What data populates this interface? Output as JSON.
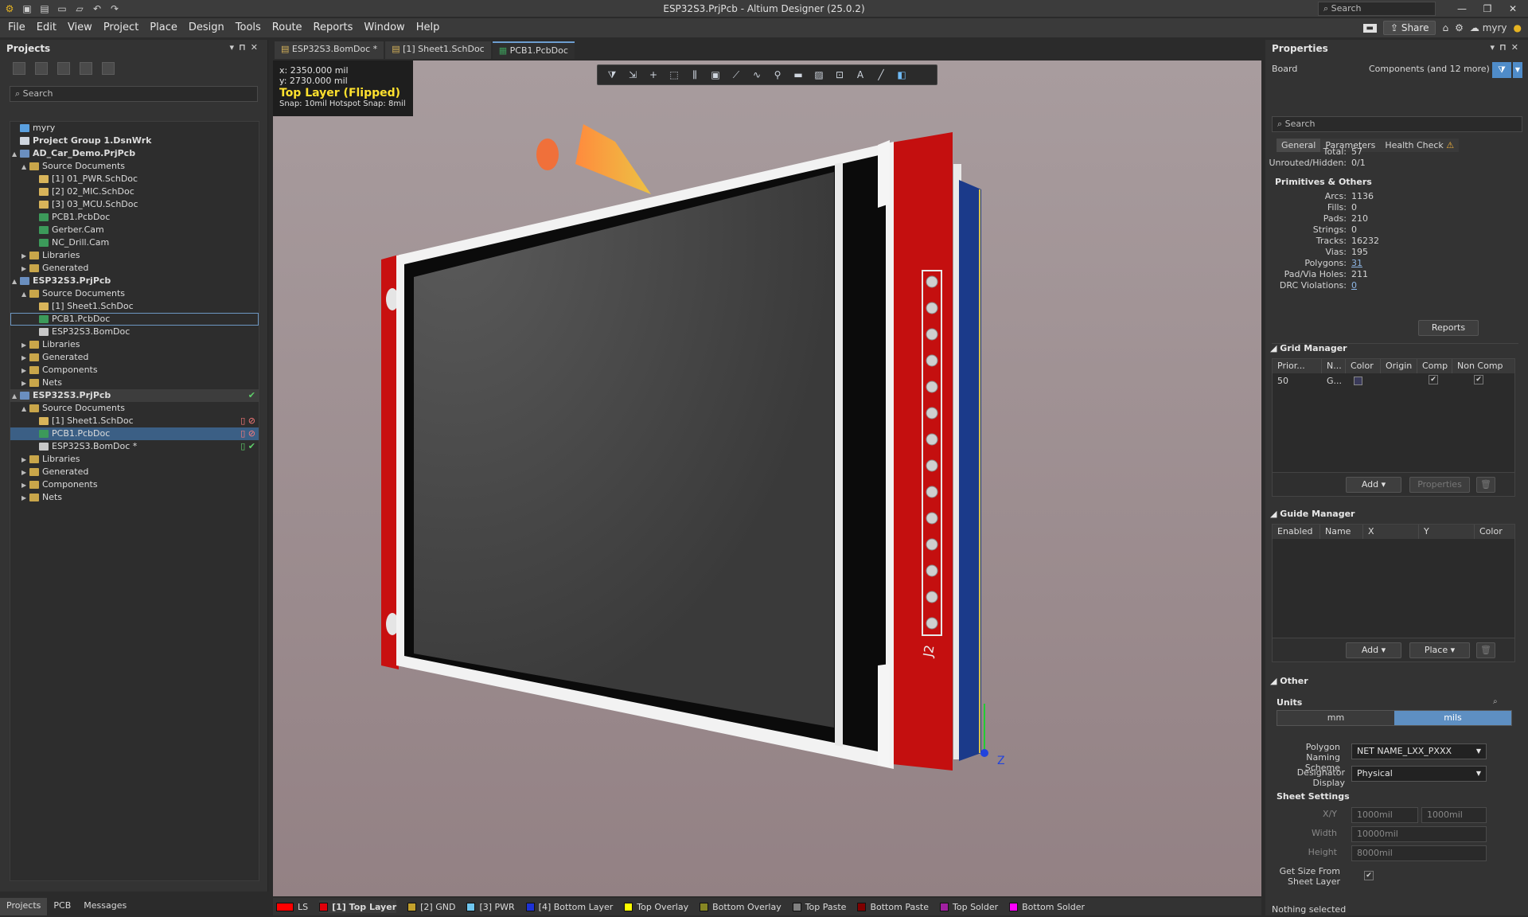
{
  "app": {
    "title": "ESP32S3.PrjPcb - Altium Designer (25.0.2)",
    "search_placeholder": "Search",
    "share_label": "Share",
    "user": "myry"
  },
  "menu": [
    "File",
    "Edit",
    "View",
    "Project",
    "Place",
    "Design",
    "Tools",
    "Route",
    "Reports",
    "Window",
    "Help"
  ],
  "projects_panel": {
    "title": "Projects",
    "search_placeholder": "Search",
    "tree": [
      {
        "label": "myry",
        "icon": "cloud-icon",
        "level": 0
      },
      {
        "label": "Project Group 1.DsnWrk",
        "icon": "workspace-icon",
        "level": 0,
        "bold": true
      },
      {
        "label": "AD_Car_Demo.PrjPcb",
        "icon": "project-icon",
        "level": 0,
        "bold": true,
        "expander": "▲"
      },
      {
        "label": "Source Documents",
        "icon": "folder-icon",
        "level": 1,
        "expander": "▲"
      },
      {
        "label": "[1] 01_PWR.SchDoc",
        "icon": "schematic-icon",
        "level": 2
      },
      {
        "label": "[2] 02_MIC.SchDoc",
        "icon": "schematic-icon",
        "level": 2
      },
      {
        "label": "[3] 03_MCU.SchDoc",
        "icon": "schematic-icon",
        "level": 2
      },
      {
        "label": "PCB1.PcbDoc",
        "icon": "pcb-icon",
        "level": 2
      },
      {
        "label": "Gerber.Cam",
        "icon": "cam-icon",
        "level": 2
      },
      {
        "label": "NC_Drill.Cam",
        "icon": "cam-icon",
        "level": 2
      },
      {
        "label": "Libraries",
        "icon": "folder-icon",
        "level": 1,
        "expander": "▶"
      },
      {
        "label": "Generated",
        "icon": "folder-icon",
        "level": 1,
        "expander": "▶"
      },
      {
        "label": "ESP32S3.PrjPcb",
        "icon": "project-icon",
        "level": 0,
        "bold": true,
        "expander": "▲"
      },
      {
        "label": "Source Documents",
        "icon": "folder-icon",
        "level": 1,
        "expander": "▲"
      },
      {
        "label": "[1] Sheet1.SchDoc",
        "icon": "schematic-icon",
        "level": 2
      },
      {
        "label": "PCB1.PcbDoc",
        "icon": "pcb-icon",
        "level": 2,
        "outline": true
      },
      {
        "label": "ESP32S3.BomDoc",
        "icon": "bom-icon",
        "level": 2
      },
      {
        "label": "Libraries",
        "icon": "folder-icon",
        "level": 1,
        "expander": "▶"
      },
      {
        "label": "Generated",
        "icon": "folder-icon",
        "level": 1,
        "expander": "▶"
      },
      {
        "label": "Components",
        "icon": "folder-icon",
        "level": 1,
        "expander": "▶"
      },
      {
        "label": "Nets",
        "icon": "folder-icon",
        "level": 1,
        "expander": "▶"
      },
      {
        "label": "ESP32S3.PrjPcb",
        "icon": "project-icon",
        "level": 0,
        "bold": true,
        "expander": "▲",
        "status": "✔",
        "active": true
      },
      {
        "label": "Source Documents",
        "icon": "folder-icon",
        "level": 1,
        "expander": "▲"
      },
      {
        "label": "[1] Sheet1.SchDoc",
        "icon": "schematic-icon",
        "level": 2,
        "status": "▯ ⊘"
      },
      {
        "label": "PCB1.PcbDoc",
        "icon": "pcb-icon",
        "level": 2,
        "selected": true,
        "status": "▯ ⊘"
      },
      {
        "label": "ESP32S3.BomDoc *",
        "icon": "bom-icon",
        "level": 2,
        "status": "▯ ✔"
      },
      {
        "label": "Libraries",
        "icon": "folder-icon",
        "level": 1,
        "expander": "▶"
      },
      {
        "label": "Generated",
        "icon": "folder-icon",
        "level": 1,
        "expander": "▶"
      },
      {
        "label": "Components",
        "icon": "folder-icon",
        "level": 1,
        "expander": "▶"
      },
      {
        "label": "Nets",
        "icon": "folder-icon",
        "level": 1,
        "expander": "▶"
      }
    ]
  },
  "bottom_tabs": [
    "Projects",
    "PCB",
    "Messages"
  ],
  "doc_tabs": [
    "ESP32S3.BomDoc *",
    "[1] Sheet1.SchDoc",
    "PCB1.PcbDoc"
  ],
  "viewport": {
    "x": "x:  2350.000  mil",
    "y": "y:  2730.000  mil",
    "layer": "Top Layer (Flipped)",
    "snap": "Snap: 10mil Hotspot Snap: 8mil",
    "designator": "J2",
    "axis_label": "Z"
  },
  "layer_tabs": [
    {
      "label": "LS",
      "color": "#ff0000"
    },
    {
      "label": "[1] Top Layer",
      "color": "#e0000a",
      "active": true
    },
    {
      "label": "[2] GND",
      "color": "#c3a12c"
    },
    {
      "label": "[3] PWR",
      "color": "#6fc6ef"
    },
    {
      "label": "[4] Bottom Layer",
      "color": "#1d32d6"
    },
    {
      "label": "Top Overlay",
      "color": "#ffff00"
    },
    {
      "label": "Bottom Overlay",
      "color": "#868624"
    },
    {
      "label": "Top Paste",
      "color": "#808080"
    },
    {
      "label": "Bottom Paste",
      "color": "#800000"
    },
    {
      "label": "Top Solder",
      "color": "#a020a0"
    },
    {
      "label": "Bottom Solder",
      "color": "#ff00ff"
    }
  ],
  "properties": {
    "title": "Properties",
    "board_label": "Board",
    "filter_label": "Components (and 12 more)",
    "search_placeholder": "Search",
    "tabs": [
      "General",
      "Parameters",
      "Health Check"
    ],
    "stats_top": [
      {
        "k": "Total:",
        "v": "57"
      },
      {
        "k": "Unrouted/Hidden:",
        "v": "0/1"
      }
    ],
    "primitives_title": "Primitives & Others",
    "primitives": [
      {
        "k": "Arcs:",
        "v": "1136"
      },
      {
        "k": "Fills:",
        "v": "0"
      },
      {
        "k": "Pads:",
        "v": "210"
      },
      {
        "k": "Strings:",
        "v": "0"
      },
      {
        "k": "Tracks:",
        "v": "16232"
      },
      {
        "k": "Vias:",
        "v": "195"
      },
      {
        "k": "Polygons:",
        "v": "31",
        "link": true
      },
      {
        "k": "Pad/Via Holes:",
        "v": "211"
      },
      {
        "k": "DRC Violations:",
        "v": "0",
        "link": true
      }
    ],
    "reports_button": "Reports",
    "grid_manager": {
      "title": "Grid Manager",
      "columns": [
        "Prior...",
        "N...",
        "Color",
        "Origin",
        "Comp",
        "Non Comp"
      ],
      "row": {
        "priority": "50",
        "name": "G...",
        "comp": "✔",
        "non_comp": "✔"
      },
      "add_button": "Add",
      "properties_button": "Properties"
    },
    "guide_manager": {
      "title": "Guide Manager",
      "columns": [
        "Enabled",
        "Name",
        "X",
        "Y",
        "Color"
      ],
      "add_button": "Add",
      "place_button": "Place"
    },
    "other": {
      "title": "Other",
      "units_label": "Units",
      "unit_options": [
        "mm",
        "mils"
      ],
      "selected_unit": "mils",
      "polygon_naming_label": "Polygon Naming Scheme",
      "polygon_naming_value": "NET NAME_LXX_PXXX",
      "designator_display_label": "Designator Display",
      "designator_display_value": "Physical"
    },
    "sheet_settings": {
      "title": "Sheet Settings",
      "xy_label": "X/Y",
      "x_value": "1000mil",
      "y_value": "1000mil",
      "width_label": "Width",
      "width_value": "10000mil",
      "height_label": "Height",
      "height_value": "8000mil",
      "get_size_label": "Get Size From Sheet Layer"
    },
    "status": "Nothing selected"
  }
}
